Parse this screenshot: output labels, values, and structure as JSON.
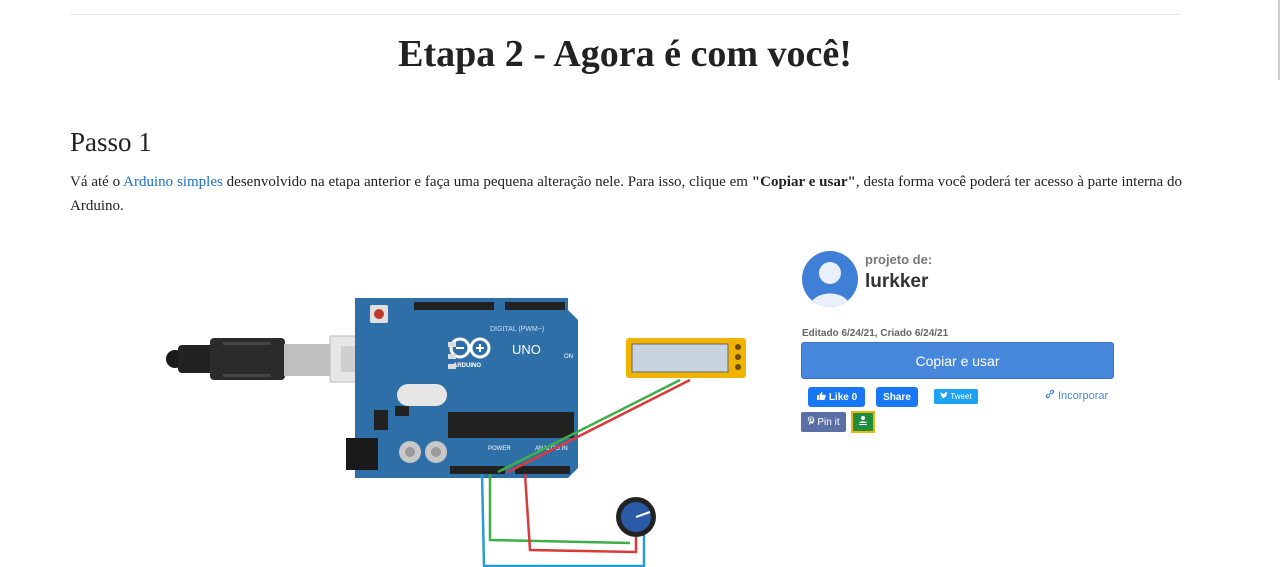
{
  "page": {
    "title": "Etapa 2 - Agora é com você!",
    "step_title": "Passo 1",
    "paragraph": {
      "text1": "Vá até o ",
      "link": "Arduino simples",
      "text2": " desenvolvido na etapa anterior e faça uma pequena alteração nele. Para isso, clique em ",
      "bold": "\"Copiar e usar\"",
      "text3": ", desta forma você poderá ter acesso à parte interna do Arduino."
    }
  },
  "circuit": {
    "board_brand": "ARDUINO",
    "board_model": "UNO",
    "board_on": "ON",
    "header_digital": "DIGITAL (PWM~)",
    "header_power": "POWER",
    "header_analog": "ANALOG IN"
  },
  "project": {
    "by_label": "projeto de:",
    "author": "lurkker",
    "dates": "Editado 6/24/21, Criado 6/24/21",
    "copy_button": "Copiar e usar",
    "like_label": "Like 0",
    "share_label": "Share",
    "tweet_label": "Tweet",
    "embed_label": "Incorporar",
    "pin_label": "Pin it"
  },
  "icons": {
    "avatar": "user-avatar-icon",
    "like": "thumbs-up-icon",
    "tweet": "twitter-bird-icon",
    "embed": "link-icon",
    "pin": "pinterest-icon",
    "classroom": "google-classroom-icon"
  },
  "colors": {
    "link": "#1a73c9",
    "primary_button": "#4787dc",
    "facebook": "#1877f2",
    "twitter": "#1da1f2",
    "pinterest": "#5a6fa6",
    "classroom": "#1e8e3e",
    "arduino_board": "#2f6fa8"
  }
}
